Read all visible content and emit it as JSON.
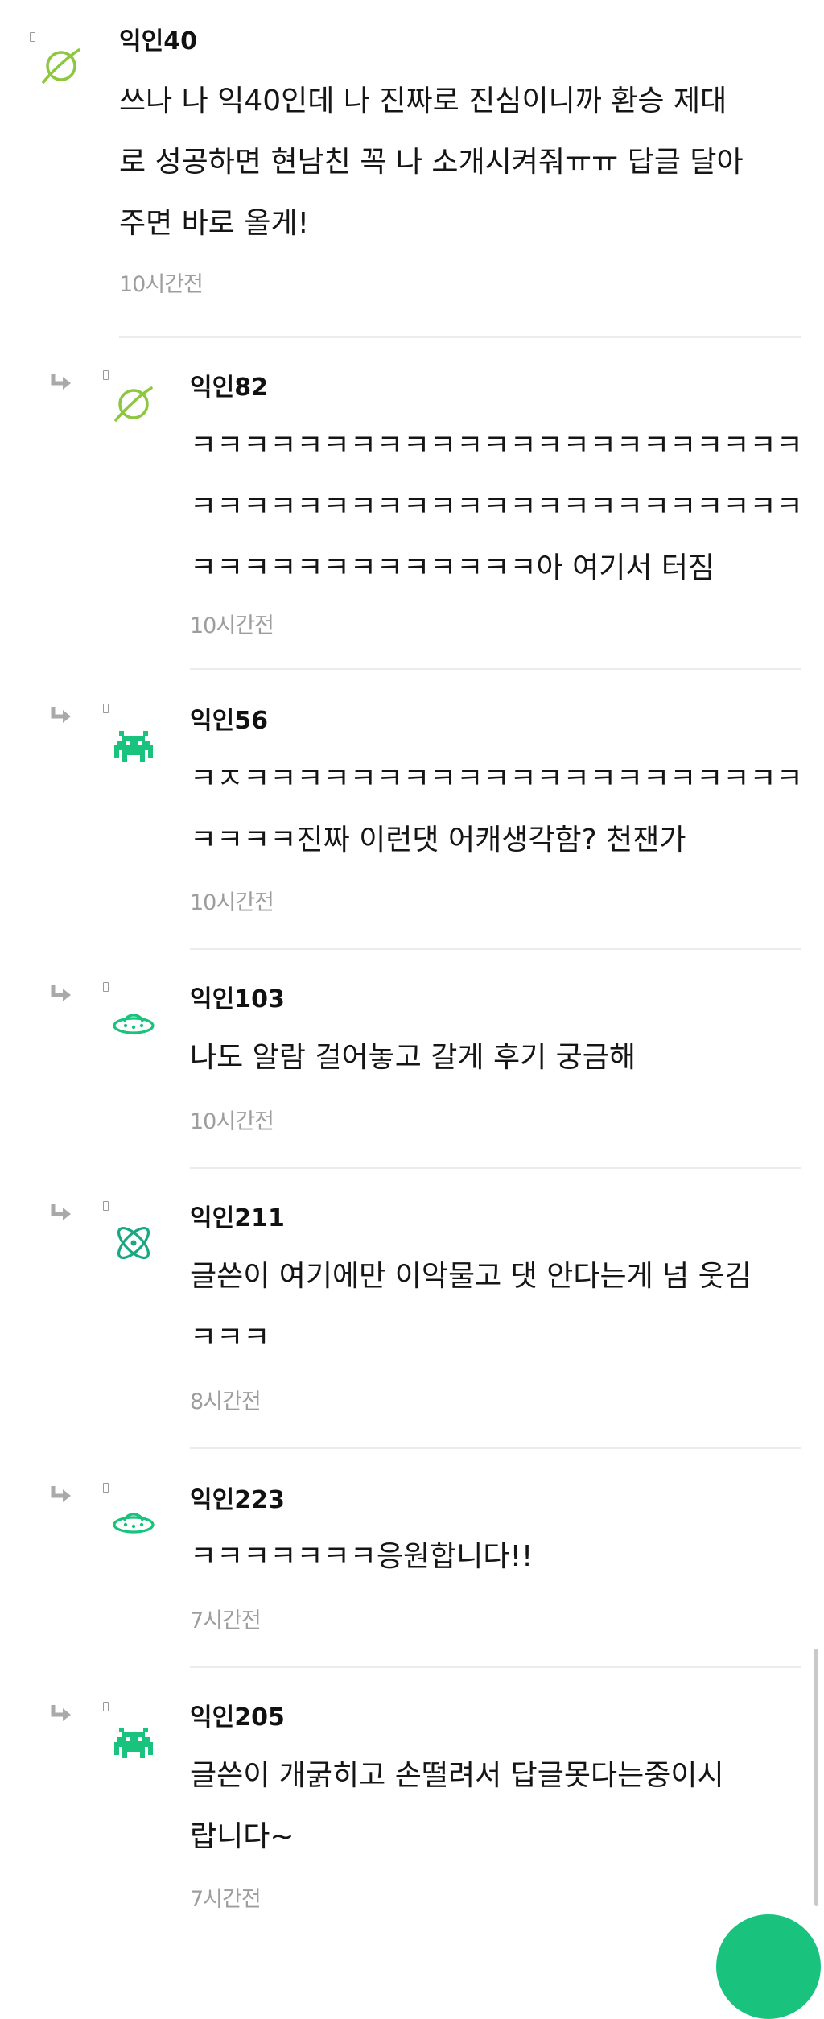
{
  "comments": [
    {
      "author": "익인40",
      "avatar_icon": "planet-icon",
      "line1": "쓰나 나 익40인데 나 진짜로 진심이니까 환승 제대",
      "line2": "로 성공하면 현남친 꼭 나 소개시켜줘ㅠㅠ 답글 달아",
      "line3": "주면 바로 올게!",
      "time": "10시간전"
    },
    {
      "author": "익인82",
      "avatar_icon": "planet-icon",
      "line1": "ㅋㅋㅋㅋㅋㅋㅋㅋㅋㅋㅋㅋㅋㅋㅋㅋㅋㅋㅋㅋㅋㅋㅋ",
      "line2": "ㅋㅋㅋㅋㅋㅋㅋㅋㅋㅋㅋㅋㅋㅋㅋㅋㅋㅋㅋㅋㅋㅋㅋ",
      "line3": "ㅋㅋㅋㅋㅋㅋㅋㅋㅋㅋㅋㅋㅋ아 여기서 터짐",
      "time": "10시간전"
    },
    {
      "author": "익인56",
      "avatar_icon": "space-invader-icon",
      "line1": "ㅋㅈㅋㅋㅋㅋㅋㅋㅋㅋㅋㅋㅋㅋㅋㅋㅋㅋㅋㅋㅋㅋㅋ",
      "line2": "ㅋㅋㅋㅋ진짜 이런댓 어캐생각함? 천잰가",
      "time": "10시간전"
    },
    {
      "author": "익인103",
      "avatar_icon": "ufo-icon",
      "line1": "나도 알람 걸어놓고 갈게 후기 궁금해",
      "time": "10시간전"
    },
    {
      "author": "익인211",
      "avatar_icon": "atom-icon",
      "line1": "글쓴이 여기에만 이악물고 댓 안다는게 넘 웃김",
      "line2": "ㅋㅋㅋ",
      "time": "8시간전"
    },
    {
      "author": "익인223",
      "avatar_icon": "ufo-icon",
      "line1": "ㅋㅋㅋㅋㅋㅋㅋ응원합니다!!",
      "time": "7시간전"
    },
    {
      "author": "익인205",
      "avatar_icon": "space-invader-icon",
      "line1": "글쓴이 개굵히고 손떨려서 답글못다는중이시",
      "line2": "랍니다~",
      "time": "7시간전"
    }
  ],
  "colors": {
    "planet": "#8dc63f",
    "invader": "#19c37d",
    "ufo": "#19c37d",
    "atom": "#19a883",
    "fab": "#19c37d"
  }
}
